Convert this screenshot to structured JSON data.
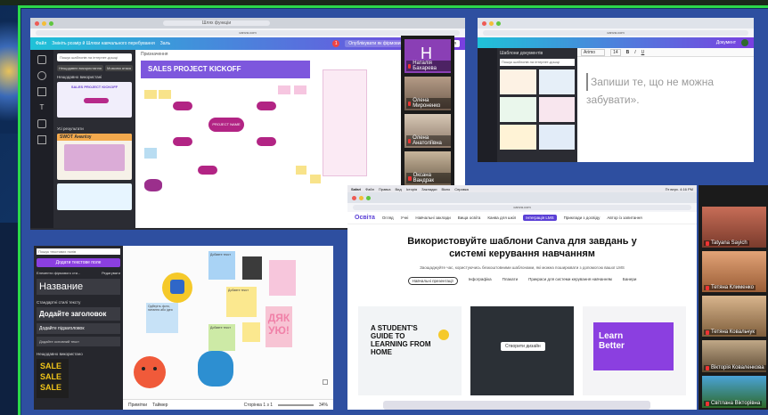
{
  "shot1": {
    "url": "canva.com",
    "tab_title": "Шлях функціи",
    "header_items": [
      "Файл",
      "Змініть розмір й Шляхи навчального перебування",
      "Заль"
    ],
    "share_label": "Поділитися",
    "template_label": "Опублікувати як фірмовий шаблон",
    "search_placeholder": "Пошук шаблонів на інтернет-дошці",
    "chips": [
      "Нещодавнє використання",
      "Мозкова атака"
    ],
    "recent_label": "Нещодавно використані",
    "results_label": "Усі результати",
    "thumb_title": "SALES PROJECT KICKOFF",
    "swot_label": "SWOT Аналізу",
    "doc_title": "SALES PROJECT KICKOFF",
    "subtitle": "Призначення",
    "center_node": "PROJECT NAME",
    "brand": "#7b4ae0"
  },
  "video_strip": [
    {
      "name": "Наталія Бахарева",
      "initial": "H"
    },
    {
      "name": "Олена Мироненко"
    },
    {
      "name": "Олена Анатоліївна"
    },
    {
      "name": "Оксана Вандрак"
    }
  ],
  "shot2": {
    "url": "canva.com",
    "back_label": "Шаблони документів",
    "search_placeholder": "Пошук шаблонів на інтернет-дошці",
    "font": "Arimo",
    "font_size": "14",
    "doc_name": "Документ",
    "quote_line1": "Запиши те, що не можна",
    "quote_line2": "забувати»."
  },
  "shot3": {
    "search_placeholder": "Пошук текстових полів",
    "add_button": "Додати текстове поле",
    "brand_kit": "Елементи фірмового сти...",
    "edit": "Редагувати",
    "heading_name": "Название",
    "default_styles": "Стандартні стилі тексту",
    "add_heading": "Додайте заголовок",
    "add_subheading": "Додайте підзаголовок",
    "add_body": "Додайте основний текст",
    "recent": "Нещодавно використано",
    "sale_text": [
      "SALE",
      "SALE",
      "SALE"
    ],
    "notes_label": "Примітки",
    "timer_label": "Таймер",
    "page_label": "Сторінка 1 з 1",
    "zoom": "34%",
    "sticky_texts": [
      "Добавте текст",
      "Добавте текст",
      "Добавте текст",
      "Одберіть фото, питання або ідея"
    ],
    "thanks": "ДЯК УЮ!"
  },
  "shot4": {
    "menubar": [
      "Safari",
      "Файл",
      "Правка",
      "Вид",
      "Історія",
      "Закладки",
      "Вікно",
      "Справка"
    ],
    "clock": "Пт верх. 4:16 PM",
    "url": "canva.com",
    "nav": [
      "Освіта",
      "Огляд",
      "Учні",
      "Навчальні заклади",
      "Вища освіта",
      "Канва для шкіл",
      "Інтеграція LMS",
      "Приклади з досвіду",
      "Автор із запитання"
    ],
    "title_line1": "Використовуйте шаблони Canva для завдань у",
    "title_line2": "системі керування навчанням",
    "subtitle": "Заощаджуйте час, користуючись безкоштовними шаблонами, які можна поширювати з допомогою вашої LMS",
    "tabs": [
      "Навчальні презентації",
      "Інфографіка",
      "Плакати",
      "Прикраси для системи керування навчанням",
      "Банери"
    ],
    "card1": "A STUDENT'S GUIDE TO LEARNING FROM HOME",
    "card2_button": "Створити дизайн",
    "card3": "Learn Better"
  },
  "video_strip2": [
    {
      "name": "Tatyana Sayich"
    },
    {
      "name": "Тетяна Клименко"
    },
    {
      "name": "Тетяна Ковальчук"
    },
    {
      "name": "Вікторія Коваленкова"
    },
    {
      "name": "Світлана Вікторівна"
    }
  ]
}
